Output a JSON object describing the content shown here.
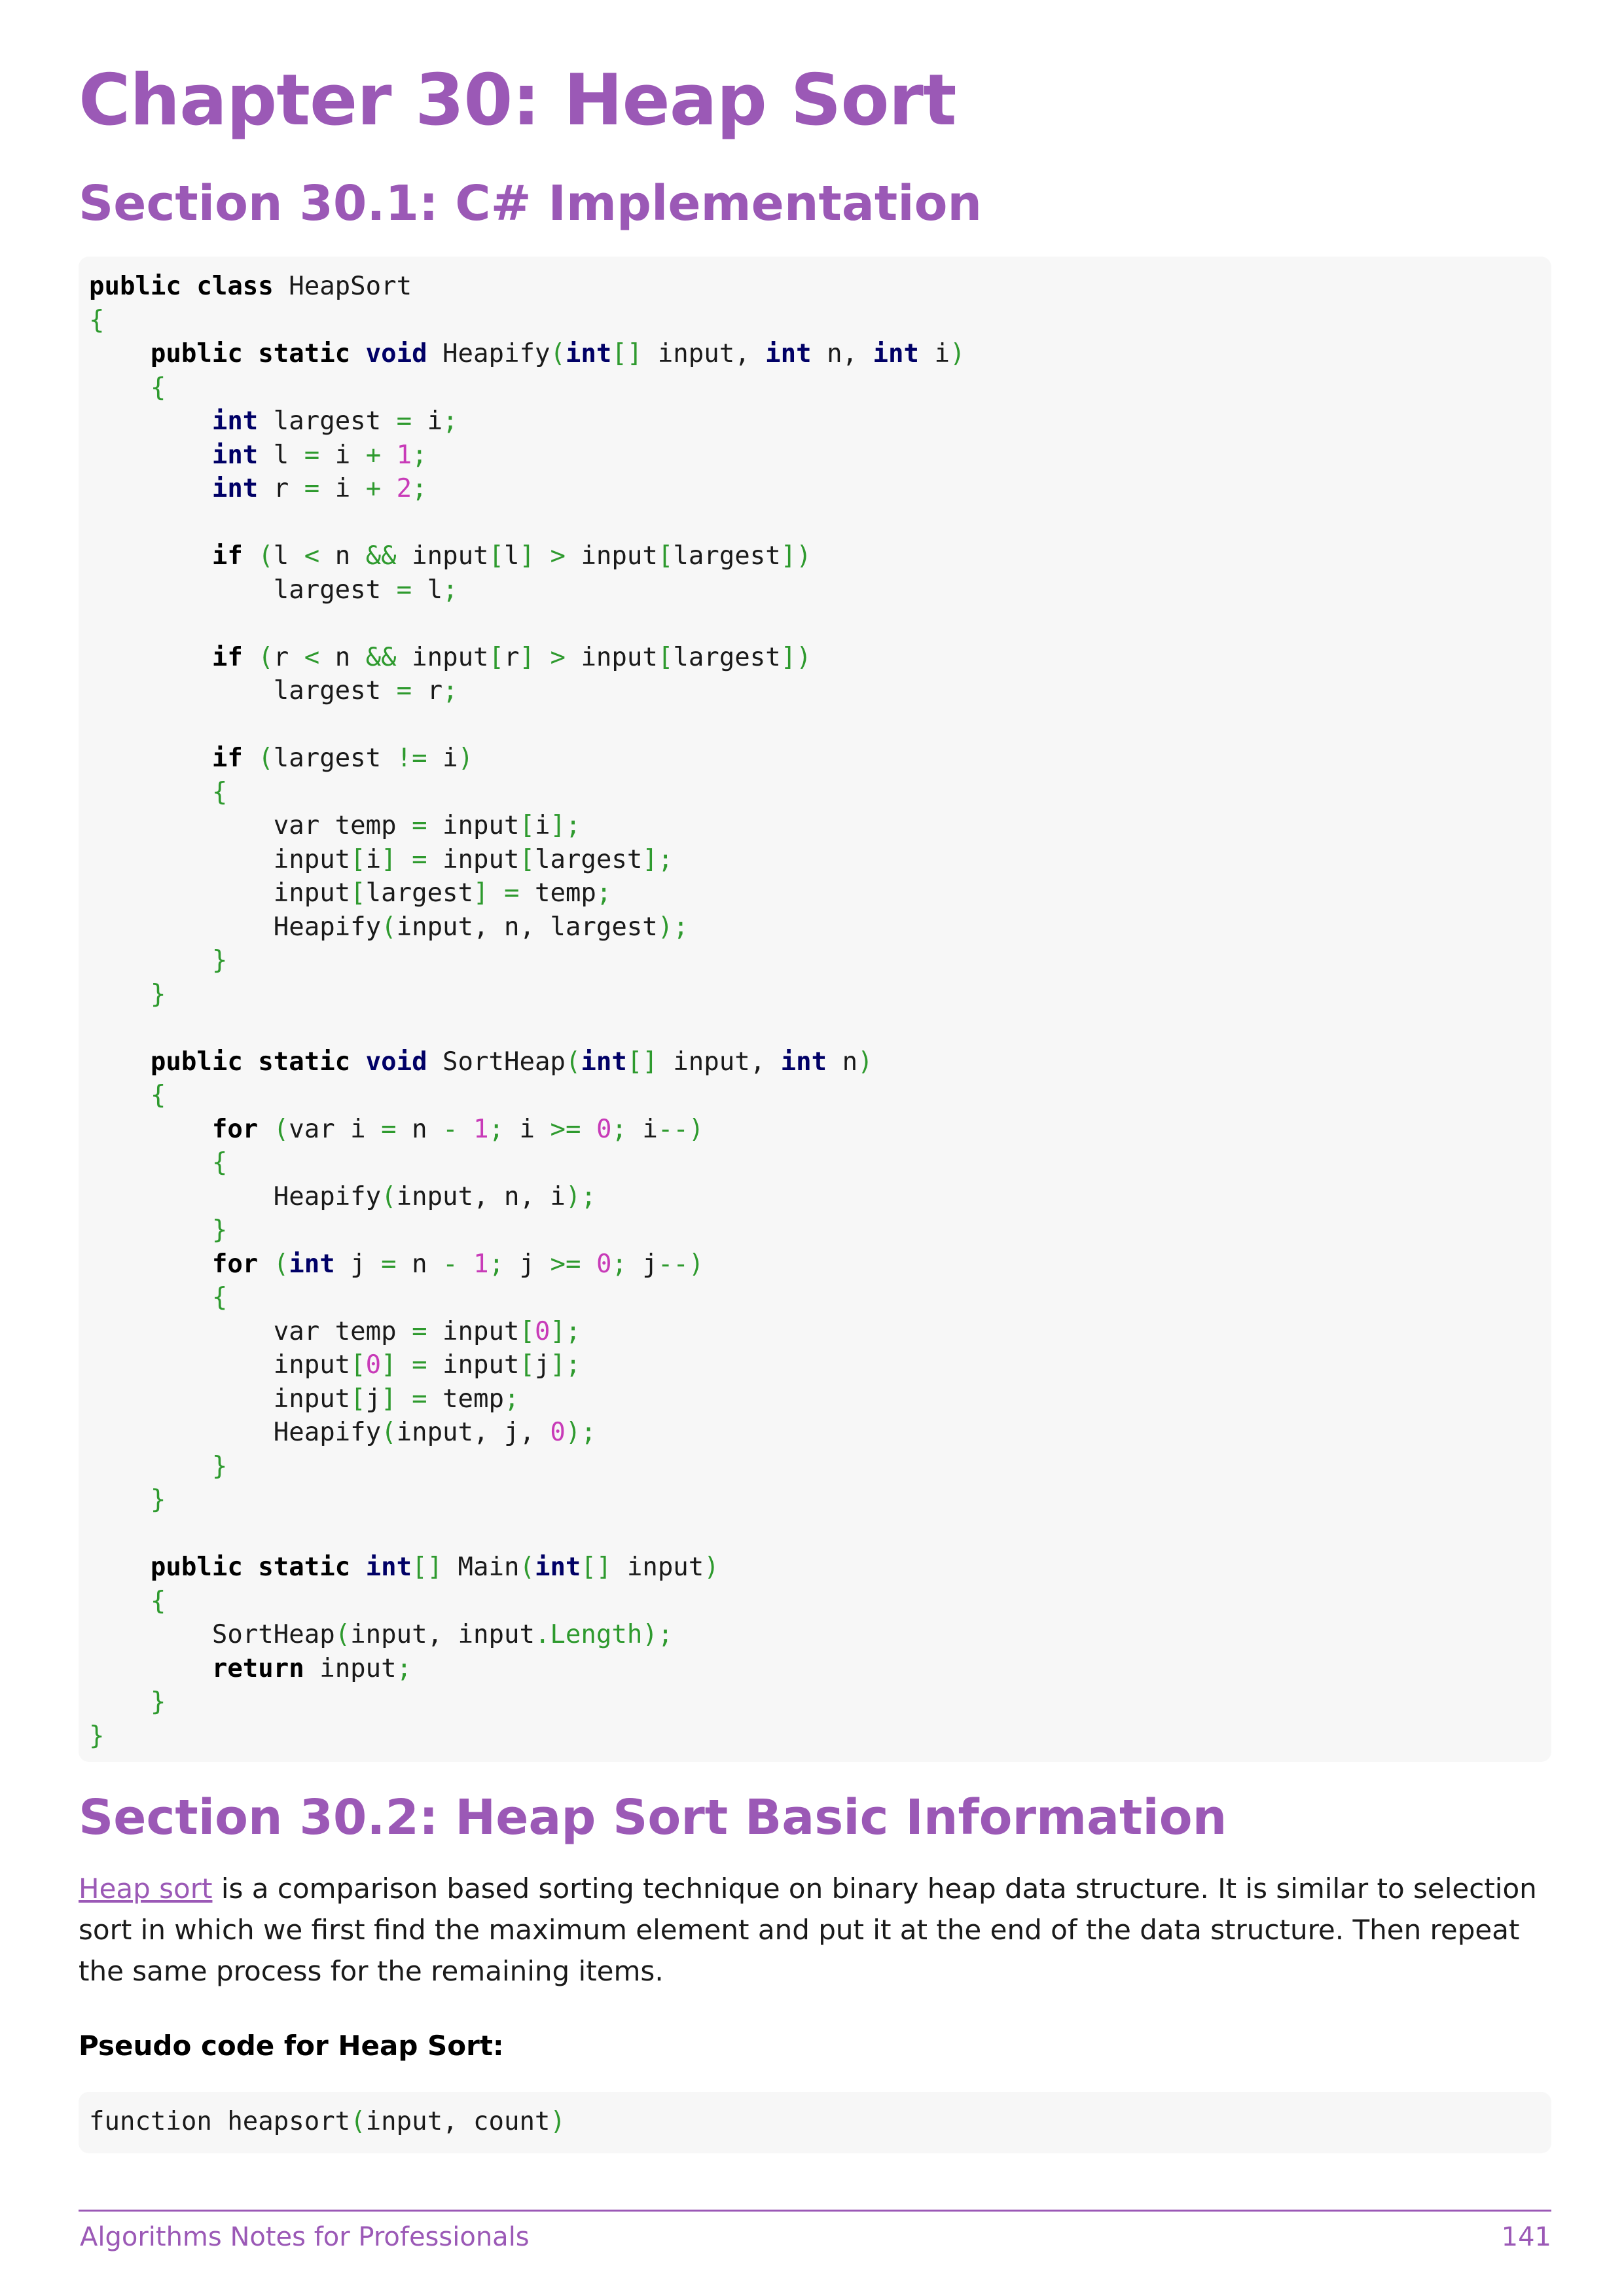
{
  "chapter_title": "Chapter 30: Heap Sort",
  "section1_title": "Section 30.1: C# Implementation",
  "code1": [
    [
      [
        "kw",
        "public class"
      ],
      [
        "t",
        " HeapSort"
      ]
    ],
    [
      [
        "p",
        "{"
      ]
    ],
    [
      [
        "t",
        "    "
      ],
      [
        "kw",
        "public static"
      ],
      [
        "t",
        " "
      ],
      [
        "ty",
        "void"
      ],
      [
        "t",
        " Heapify"
      ],
      [
        "p",
        "("
      ],
      [
        "ty",
        "int"
      ],
      [
        "p",
        "[]"
      ],
      [
        "t",
        " input, "
      ],
      [
        "ty",
        "int"
      ],
      [
        "t",
        " n, "
      ],
      [
        "ty",
        "int"
      ],
      [
        "t",
        " i"
      ],
      [
        "p",
        ")"
      ]
    ],
    [
      [
        "t",
        "    "
      ],
      [
        "p",
        "{"
      ]
    ],
    [
      [
        "t",
        "        "
      ],
      [
        "ty",
        "int"
      ],
      [
        "t",
        " largest "
      ],
      [
        "p",
        "="
      ],
      [
        "t",
        " i"
      ],
      [
        "p",
        ";"
      ]
    ],
    [
      [
        "t",
        "        "
      ],
      [
        "ty",
        "int"
      ],
      [
        "t",
        " l "
      ],
      [
        "p",
        "="
      ],
      [
        "t",
        " i "
      ],
      [
        "p",
        "+"
      ],
      [
        "t",
        " "
      ],
      [
        "n",
        "1"
      ],
      [
        "p",
        ";"
      ]
    ],
    [
      [
        "t",
        "        "
      ],
      [
        "ty",
        "int"
      ],
      [
        "t",
        " r "
      ],
      [
        "p",
        "="
      ],
      [
        "t",
        " i "
      ],
      [
        "p",
        "+"
      ],
      [
        "t",
        " "
      ],
      [
        "n",
        "2"
      ],
      [
        "p",
        ";"
      ]
    ],
    [
      [
        "t",
        ""
      ]
    ],
    [
      [
        "t",
        "        "
      ],
      [
        "kw",
        "if"
      ],
      [
        "t",
        " "
      ],
      [
        "p",
        "("
      ],
      [
        "t",
        "l "
      ],
      [
        "p",
        "<"
      ],
      [
        "t",
        " n "
      ],
      [
        "p",
        "&&"
      ],
      [
        "t",
        " input"
      ],
      [
        "p",
        "["
      ],
      [
        "t",
        "l"
      ],
      [
        "p",
        "]"
      ],
      [
        "t",
        " "
      ],
      [
        "p",
        ">"
      ],
      [
        "t",
        " input"
      ],
      [
        "p",
        "["
      ],
      [
        "t",
        "largest"
      ],
      [
        "p",
        "])"
      ]
    ],
    [
      [
        "t",
        "            largest "
      ],
      [
        "p",
        "="
      ],
      [
        "t",
        " l"
      ],
      [
        "p",
        ";"
      ]
    ],
    [
      [
        "t",
        ""
      ]
    ],
    [
      [
        "t",
        "        "
      ],
      [
        "kw",
        "if"
      ],
      [
        "t",
        " "
      ],
      [
        "p",
        "("
      ],
      [
        "t",
        "r "
      ],
      [
        "p",
        "<"
      ],
      [
        "t",
        " n "
      ],
      [
        "p",
        "&&"
      ],
      [
        "t",
        " input"
      ],
      [
        "p",
        "["
      ],
      [
        "t",
        "r"
      ],
      [
        "p",
        "]"
      ],
      [
        "t",
        " "
      ],
      [
        "p",
        ">"
      ],
      [
        "t",
        " input"
      ],
      [
        "p",
        "["
      ],
      [
        "t",
        "largest"
      ],
      [
        "p",
        "])"
      ]
    ],
    [
      [
        "t",
        "            largest "
      ],
      [
        "p",
        "="
      ],
      [
        "t",
        " r"
      ],
      [
        "p",
        ";"
      ]
    ],
    [
      [
        "t",
        ""
      ]
    ],
    [
      [
        "t",
        "        "
      ],
      [
        "kw",
        "if"
      ],
      [
        "t",
        " "
      ],
      [
        "p",
        "("
      ],
      [
        "t",
        "largest "
      ],
      [
        "p",
        "!="
      ],
      [
        "t",
        " i"
      ],
      [
        "p",
        ")"
      ]
    ],
    [
      [
        "t",
        "        "
      ],
      [
        "p",
        "{"
      ]
    ],
    [
      [
        "t",
        "            var temp "
      ],
      [
        "p",
        "="
      ],
      [
        "t",
        " input"
      ],
      [
        "p",
        "["
      ],
      [
        "t",
        "i"
      ],
      [
        "p",
        "];"
      ]
    ],
    [
      [
        "t",
        "            input"
      ],
      [
        "p",
        "["
      ],
      [
        "t",
        "i"
      ],
      [
        "p",
        "]"
      ],
      [
        "t",
        " "
      ],
      [
        "p",
        "="
      ],
      [
        "t",
        " input"
      ],
      [
        "p",
        "["
      ],
      [
        "t",
        "largest"
      ],
      [
        "p",
        "];"
      ]
    ],
    [
      [
        "t",
        "            input"
      ],
      [
        "p",
        "["
      ],
      [
        "t",
        "largest"
      ],
      [
        "p",
        "]"
      ],
      [
        "t",
        " "
      ],
      [
        "p",
        "="
      ],
      [
        "t",
        " temp"
      ],
      [
        "p",
        ";"
      ]
    ],
    [
      [
        "t",
        "            Heapify"
      ],
      [
        "p",
        "("
      ],
      [
        "t",
        "input, n, largest"
      ],
      [
        "p",
        ");"
      ]
    ],
    [
      [
        "t",
        "        "
      ],
      [
        "p",
        "}"
      ]
    ],
    [
      [
        "t",
        "    "
      ],
      [
        "p",
        "}"
      ]
    ],
    [
      [
        "t",
        ""
      ]
    ],
    [
      [
        "t",
        "    "
      ],
      [
        "kw",
        "public static"
      ],
      [
        "t",
        " "
      ],
      [
        "ty",
        "void"
      ],
      [
        "t",
        " SortHeap"
      ],
      [
        "p",
        "("
      ],
      [
        "ty",
        "int"
      ],
      [
        "p",
        "[]"
      ],
      [
        "t",
        " input, "
      ],
      [
        "ty",
        "int"
      ],
      [
        "t",
        " n"
      ],
      [
        "p",
        ")"
      ]
    ],
    [
      [
        "t",
        "    "
      ],
      [
        "p",
        "{"
      ]
    ],
    [
      [
        "t",
        "        "
      ],
      [
        "kw",
        "for"
      ],
      [
        "t",
        " "
      ],
      [
        "p",
        "("
      ],
      [
        "t",
        "var i "
      ],
      [
        "p",
        "="
      ],
      [
        "t",
        " n "
      ],
      [
        "p",
        "-"
      ],
      [
        "t",
        " "
      ],
      [
        "n",
        "1"
      ],
      [
        "p",
        ";"
      ],
      [
        "t",
        " i "
      ],
      [
        "p",
        ">="
      ],
      [
        "t",
        " "
      ],
      [
        "n",
        "0"
      ],
      [
        "p",
        ";"
      ],
      [
        "t",
        " i"
      ],
      [
        "p",
        "--)"
      ]
    ],
    [
      [
        "t",
        "        "
      ],
      [
        "p",
        "{"
      ]
    ],
    [
      [
        "t",
        "            Heapify"
      ],
      [
        "p",
        "("
      ],
      [
        "t",
        "input, n, i"
      ],
      [
        "p",
        ");"
      ]
    ],
    [
      [
        "t",
        "        "
      ],
      [
        "p",
        "}"
      ]
    ],
    [
      [
        "t",
        "        "
      ],
      [
        "kw",
        "for"
      ],
      [
        "t",
        " "
      ],
      [
        "p",
        "("
      ],
      [
        "ty",
        "int"
      ],
      [
        "t",
        " j "
      ],
      [
        "p",
        "="
      ],
      [
        "t",
        " n "
      ],
      [
        "p",
        "-"
      ],
      [
        "t",
        " "
      ],
      [
        "n",
        "1"
      ],
      [
        "p",
        ";"
      ],
      [
        "t",
        " j "
      ],
      [
        "p",
        ">="
      ],
      [
        "t",
        " "
      ],
      [
        "n",
        "0"
      ],
      [
        "p",
        ";"
      ],
      [
        "t",
        " j"
      ],
      [
        "p",
        "--)"
      ]
    ],
    [
      [
        "t",
        "        "
      ],
      [
        "p",
        "{"
      ]
    ],
    [
      [
        "t",
        "            var temp "
      ],
      [
        "p",
        "="
      ],
      [
        "t",
        " input"
      ],
      [
        "p",
        "["
      ],
      [
        "n",
        "0"
      ],
      [
        "p",
        "];"
      ]
    ],
    [
      [
        "t",
        "            input"
      ],
      [
        "p",
        "["
      ],
      [
        "n",
        "0"
      ],
      [
        "p",
        "]"
      ],
      [
        "t",
        " "
      ],
      [
        "p",
        "="
      ],
      [
        "t",
        " input"
      ],
      [
        "p",
        "["
      ],
      [
        "t",
        "j"
      ],
      [
        "p",
        "];"
      ]
    ],
    [
      [
        "t",
        "            input"
      ],
      [
        "p",
        "["
      ],
      [
        "t",
        "j"
      ],
      [
        "p",
        "]"
      ],
      [
        "t",
        " "
      ],
      [
        "p",
        "="
      ],
      [
        "t",
        " temp"
      ],
      [
        "p",
        ";"
      ]
    ],
    [
      [
        "t",
        "            Heapify"
      ],
      [
        "p",
        "("
      ],
      [
        "t",
        "input, j, "
      ],
      [
        "n",
        "0"
      ],
      [
        "p",
        ");"
      ]
    ],
    [
      [
        "t",
        "        "
      ],
      [
        "p",
        "}"
      ]
    ],
    [
      [
        "t",
        "    "
      ],
      [
        "p",
        "}"
      ]
    ],
    [
      [
        "t",
        ""
      ]
    ],
    [
      [
        "t",
        "    "
      ],
      [
        "kw",
        "public static"
      ],
      [
        "t",
        " "
      ],
      [
        "ty",
        "int"
      ],
      [
        "p",
        "[]"
      ],
      [
        "t",
        " Main"
      ],
      [
        "p",
        "("
      ],
      [
        "ty",
        "int"
      ],
      [
        "p",
        "[]"
      ],
      [
        "t",
        " input"
      ],
      [
        "p",
        ")"
      ]
    ],
    [
      [
        "t",
        "    "
      ],
      [
        "p",
        "{"
      ]
    ],
    [
      [
        "t",
        "        SortHeap"
      ],
      [
        "p",
        "("
      ],
      [
        "t",
        "input, input"
      ],
      [
        "p",
        "."
      ],
      [
        "m",
        "Length"
      ],
      [
        "p",
        ");"
      ]
    ],
    [
      [
        "t",
        "        "
      ],
      [
        "kw",
        "return"
      ],
      [
        "t",
        " input"
      ],
      [
        "p",
        ";"
      ]
    ],
    [
      [
        "t",
        "    "
      ],
      [
        "p",
        "}"
      ]
    ],
    [
      [
        "p",
        "}"
      ]
    ]
  ],
  "section2_title": "Section 30.2: Heap Sort Basic Information",
  "paragraph": {
    "link_text": "Heap sort",
    "text": " is a comparison based sorting technique on binary heap data structure. It is similar to selection sort in which we first find the maximum element and put it at the end of the data structure. Then repeat the same process for the remaining items."
  },
  "pseudo_heading": "Pseudo code for Heap Sort:",
  "code2": [
    [
      [
        "t",
        "function heapsort"
      ],
      [
        "p",
        "("
      ],
      [
        "t",
        "input, count"
      ],
      [
        "p",
        ")"
      ]
    ]
  ],
  "footer": {
    "book_title": "Algorithms Notes for Professionals",
    "page_number": "141"
  },
  "colors": {
    "heading": "#9b59b6",
    "code_background": "#f7f7f7",
    "code_punctuation": "#2e9a2e",
    "code_number": "#c83bb8",
    "code_type": "#000066"
  }
}
